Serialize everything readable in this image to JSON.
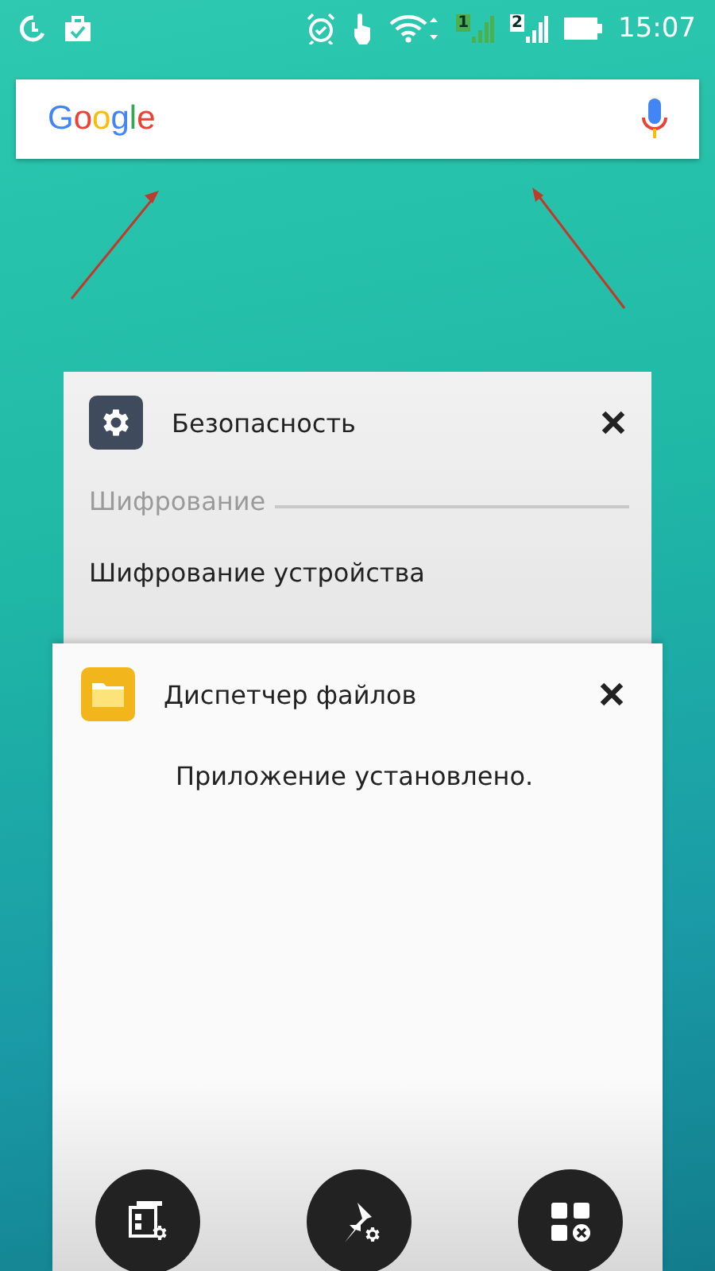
{
  "status_bar": {
    "time": "15:07",
    "sims": [
      {
        "label": "1",
        "color": "#4caf50"
      },
      {
        "label": "2",
        "color": "#ffffff"
      }
    ]
  },
  "search": {
    "logo": "Google"
  },
  "recent_apps": [
    {
      "kind": "settings",
      "title": "Безопасность",
      "section": "Шифрование",
      "item": "Шифрование устройства"
    },
    {
      "kind": "files",
      "title": "Диспетчер файлов",
      "message": "Приложение установлено."
    }
  ],
  "actions": [
    {
      "kind": "manage"
    },
    {
      "kind": "pin"
    },
    {
      "kind": "close_all"
    }
  ]
}
